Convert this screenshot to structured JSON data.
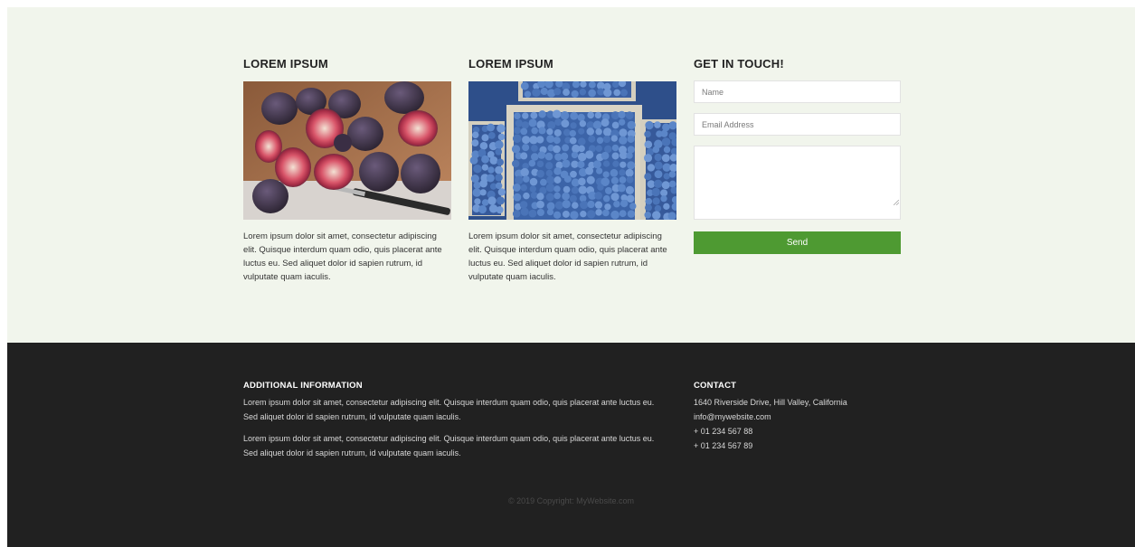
{
  "columns": [
    {
      "heading": "LOREM IPSUM",
      "image_icon": "figs-photo",
      "text": "Lorem ipsum dolor sit amet, consectetur adipiscing elit. Quisque interdum quam odio, quis placerat ante luctus eu. Sed aliquet dolor id sapien rutrum, id vulputate quam iaculis."
    },
    {
      "heading": "LOREM IPSUM",
      "image_icon": "blueberries-photo",
      "text": "Lorem ipsum dolor sit amet, consectetur adipiscing elit. Quisque interdum quam odio, quis placerat ante luctus eu. Sed aliquet dolor id sapien rutrum, id vulputate quam iaculis."
    }
  ],
  "contact_form": {
    "heading": "GET IN TOUCH!",
    "name_placeholder": "Name",
    "email_placeholder": "Email Address",
    "message_placeholder": "",
    "send_label": "Send"
  },
  "footer": {
    "info_heading": "ADDITIONAL INFORMATION",
    "info_paragraphs": [
      "Lorem ipsum dolor sit amet, consectetur adipiscing elit. Quisque interdum quam odio, quis placerat ante luctus eu. Sed aliquet dolor id sapien rutrum, id vulputate quam iaculis.",
      "Lorem ipsum dolor sit amet, consectetur adipiscing elit. Quisque interdum quam odio, quis placerat ante luctus eu. Sed aliquet dolor id sapien rutrum, id vulputate quam iaculis."
    ],
    "contact_heading": "CONTACT",
    "contact_lines": [
      "1640 Riverside Drive, Hill Valley, California",
      "info@mywebsite.com",
      "+ 01 234 567 88",
      "+ 01 234 567 89"
    ],
    "copyright": "© 2019 Copyright: MyWebsite.com"
  },
  "colors": {
    "top_background": "#f1f5ec",
    "footer_background": "#212121",
    "send_button": "#4e9a32"
  }
}
